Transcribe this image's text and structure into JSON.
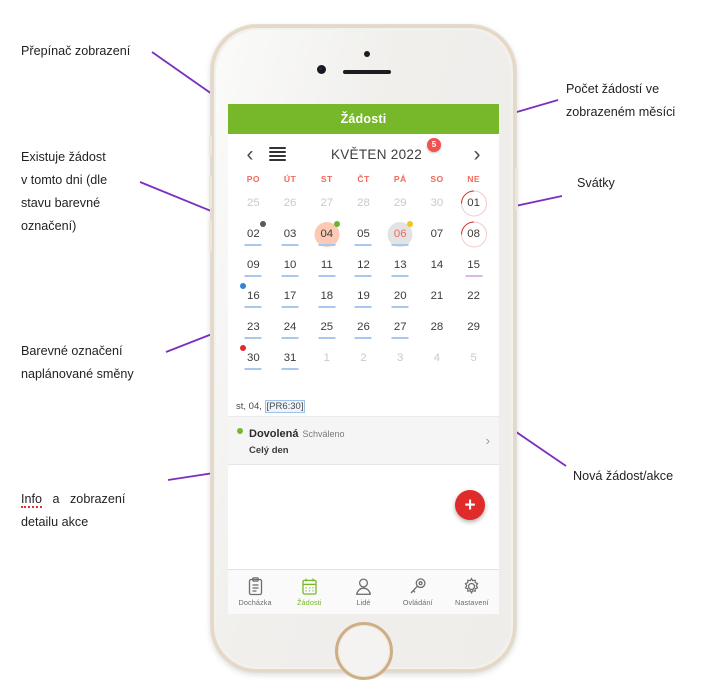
{
  "annotations": {
    "left": [
      {
        "id": "view-switcher",
        "lines": [
          "Přepínač zobrazení"
        ]
      },
      {
        "id": "request-exists",
        "lines": [
          "Existuje   žádost",
          "v tomto  dni  (dle",
          "stavu     barevné",
          "označení)"
        ]
      },
      {
        "id": "shift-color-mark",
        "lines": [
          "Barevné    označení",
          "naplánované směny"
        ]
      },
      {
        "id": "detail-info",
        "lines": [
          "Info   a   zobrazení",
          "detailu akce"
        ],
        "spell_first_word": "Info"
      }
    ],
    "right": [
      {
        "id": "request-count",
        "lines": [
          "Počet   žádostí   ve",
          "zobrazeném měsíci"
        ]
      },
      {
        "id": "holidays",
        "lines": [
          "Svátky"
        ]
      },
      {
        "id": "new-request",
        "lines": [
          "Nová žádost/akce"
        ]
      }
    ]
  },
  "phone": {
    "app": {
      "title": "Žádosti",
      "nav": {
        "prev": "‹",
        "next": "›",
        "month": "KVĚTEN 2022",
        "badge": "5",
        "list_icon": "list-view-icon"
      },
      "weekdays": [
        "PO",
        "ÚT",
        "ST",
        "ČT",
        "PÁ",
        "SO",
        "NE"
      ],
      "weeks": [
        [
          {
            "label": "25",
            "muted": true
          },
          {
            "label": "26",
            "muted": true
          },
          {
            "label": "27",
            "muted": true
          },
          {
            "label": "28",
            "muted": true
          },
          {
            "label": "29",
            "muted": true
          },
          {
            "label": "30",
            "muted": true
          },
          {
            "label": "01",
            "ring": true,
            "arc": true
          }
        ],
        [
          {
            "label": "02",
            "underline": "blue",
            "dot": {
              "color": "#595959",
              "pos": "tr"
            }
          },
          {
            "label": "03",
            "underline": "blue"
          },
          {
            "label": "04",
            "underline": "blue",
            "disc": "peach",
            "dot": {
              "color": "#6ab42f",
              "pos": "tr"
            }
          },
          {
            "label": "05",
            "underline": "blue"
          },
          {
            "label": "06",
            "underline": "blue",
            "disc": "grey",
            "red": true,
            "dot": {
              "color": "#f6c21b",
              "pos": "tr"
            }
          },
          {
            "label": "07"
          },
          {
            "label": "08",
            "ring": true,
            "arc": true
          }
        ],
        [
          {
            "label": "09",
            "underline": "blue"
          },
          {
            "label": "10",
            "underline": "blue"
          },
          {
            "label": "11",
            "underline": "blue"
          },
          {
            "label": "12",
            "underline": "blue"
          },
          {
            "label": "13",
            "underline": "blue"
          },
          {
            "label": "14"
          },
          {
            "label": "15",
            "underline": "violet"
          }
        ],
        [
          {
            "label": "16",
            "underline": "blue",
            "dot": {
              "color": "#2f86d6",
              "pos": "tl"
            }
          },
          {
            "label": "17",
            "underline": "blue"
          },
          {
            "label": "18",
            "underline": "blue"
          },
          {
            "label": "19",
            "underline": "blue"
          },
          {
            "label": "20",
            "underline": "blue"
          },
          {
            "label": "21"
          },
          {
            "label": "22"
          }
        ],
        [
          {
            "label": "23",
            "underline": "blue"
          },
          {
            "label": "24",
            "underline": "blue"
          },
          {
            "label": "25",
            "underline": "blue"
          },
          {
            "label": "26",
            "underline": "blue"
          },
          {
            "label": "27",
            "underline": "blue"
          },
          {
            "label": "28"
          },
          {
            "label": "29"
          }
        ],
        [
          {
            "label": "30",
            "underline": "blue",
            "dot": {
              "color": "#e02b2b",
              "pos": "tl"
            }
          },
          {
            "label": "31",
            "underline": "blue"
          },
          {
            "label": "1",
            "muted": true
          },
          {
            "label": "2",
            "muted": true
          },
          {
            "label": "3",
            "muted": true
          },
          {
            "label": "4",
            "muted": true
          },
          {
            "label": "5",
            "muted": true
          }
        ]
      ],
      "fab": {
        "label": "+",
        "name": "add-request-button"
      },
      "selected_day_bar": {
        "prefix": "st, 04, ",
        "tag": "[PR6:30]"
      },
      "event": {
        "title": "Dovolená",
        "status": "Schváleno",
        "subtitle": "Celý den",
        "chevron": "›"
      },
      "tabs": [
        {
          "label": "Docházka",
          "icon": "clipboard-icon",
          "active": false
        },
        {
          "label": "Žádosti",
          "icon": "calendar-icon",
          "active": true
        },
        {
          "label": "Lidé",
          "icon": "person-icon",
          "active": false
        },
        {
          "label": "Ovládání",
          "icon": "key-icon",
          "active": false
        },
        {
          "label": "Nastavení",
          "icon": "gear-icon",
          "active": false
        }
      ]
    }
  },
  "colors": {
    "brand_green": "#76b82a",
    "accent_red": "#e02b2b",
    "weekday_red": "#f1675c",
    "badge_red": "#ef5350",
    "underline_blue": "#a9c7ef",
    "underline_violet": "#dcb6e8",
    "leader_purple": "#7b2fbe"
  }
}
